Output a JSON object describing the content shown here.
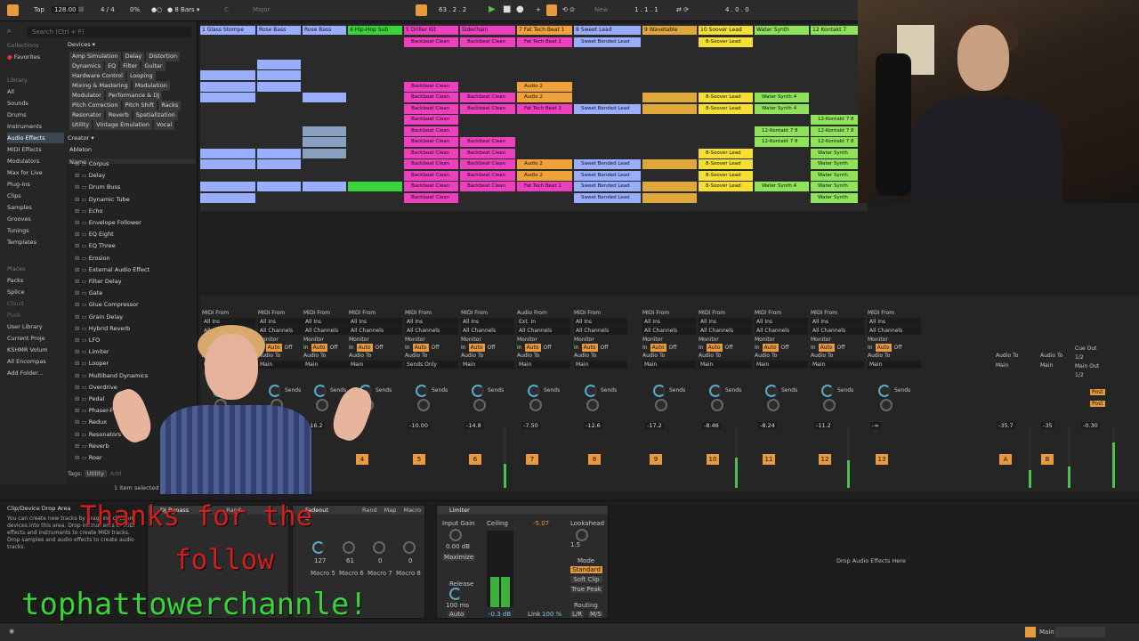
{
  "transport": {
    "tap": "Tap",
    "bpm": "128.00",
    "signature": "4 / 4",
    "cpu": "0%",
    "quantize": "8 Bars",
    "key": "C",
    "scale": "Major",
    "position": "63 .  2 .  2",
    "new_label": "New",
    "loop_start": "1 .  1 .  1",
    "loop_len": "4 .  0 .  0"
  },
  "browser": {
    "search_placeholder": "Search (Ctrl + F)",
    "collections_header": "Collections",
    "favorites": "Favorites",
    "library_header": "Library",
    "library_items": [
      "All",
      "Sounds",
      "Drums",
      "Instruments",
      "Audio Effects",
      "MIDI Effects",
      "Modulators",
      "Max for Live",
      "Plug-Ins",
      "Clips",
      "Samples",
      "Grooves",
      "Tunings",
      "Templates"
    ],
    "places_header": "Places",
    "places_items": [
      "Packs",
      "Splice",
      "Cloud",
      "Push",
      "User Library",
      "Current Proje",
      "KSHMR Volum",
      "All Encompas",
      "Add Folder..."
    ],
    "devices_label": "Devices ▾",
    "tag_rows": [
      [
        "Amp Simulation",
        "Delay",
        "Distortion"
      ],
      [
        "Dynamics",
        "EQ",
        "Filter",
        "Guitar"
      ],
      [
        "Hardware Control",
        "Looping"
      ],
      [
        "Mixing & Mastering",
        "Modulation"
      ],
      [
        "Modulator",
        "Performance & DJ"
      ],
      [
        "Pitch Correction",
        "Pitch Shift",
        "Racks"
      ],
      [
        "Resonator",
        "Reverb",
        "Spatialization"
      ],
      [
        "Utility",
        "Vintage Emulation",
        "Vocal"
      ]
    ],
    "creator_label": "Creator ▾",
    "creator_value": "Ableton",
    "name_col": "Name",
    "files": [
      "Corpus",
      "Delay",
      "Drum Buss",
      "Dynamic Tube",
      "Echo",
      "Envelope Follower",
      "EQ Eight",
      "EQ Three",
      "Erosion",
      "External Audio Effect",
      "Filter Delay",
      "Gate",
      "Glue Compressor",
      "Grain Delay",
      "Hybrid Reverb",
      "LFO",
      "Limiter",
      "Looper",
      "Multiband Dynamics",
      "Overdrive",
      "Pedal",
      "Phaser-Flanger",
      "Redux",
      "Resonators",
      "Reverb",
      "Roar"
    ],
    "tags_label": "Tags:",
    "tags_value": "Utility",
    "tags_add": "Add",
    "selected_count": "1 item selected"
  },
  "tracks": [
    {
      "name": "1 Glass Stompe",
      "color": "#9aaeff"
    },
    {
      "name": "Rose Bass",
      "color": "#9aaeff"
    },
    {
      "name": "Rose Bass",
      "color": "#9aaeff"
    },
    {
      "name": "4 Hip-Hop Sub",
      "color": "#39d439"
    },
    {
      "name": "5 Driller Kit",
      "color": "#ee3fbf"
    },
    {
      "name": "Sidechain",
      "color": "#ee3fbf"
    },
    {
      "name": "7 Fat Tech Beat 1",
      "color": "#f0a23a"
    },
    {
      "name": "8 Sweet Lead",
      "color": "#9aaeff"
    },
    {
      "name": "9 Wavetable",
      "color": "#e0a83a"
    },
    {
      "name": "10 Soover Lead",
      "color": "#f5df34"
    },
    {
      "name": "Water Synth",
      "color": "#8fe35a"
    },
    {
      "name": "12 Kontakt 7",
      "color": "#8fe35a"
    }
  ],
  "clips": {
    "backbeat": "Backbeat Clean",
    "fattech": "Fat Tech Beat 1",
    "sweet": "Sweet Bended Lead",
    "soover": "8-Soover Lead",
    "water": "Water Synth 4",
    "kontakt": "12-Kontakt 7 8",
    "audio2": "Audio 2",
    "water_short": "Water Synth"
  },
  "io": {
    "midi_from": "MIDI From",
    "audio_from": "Audio From",
    "all_ins": "All Ins",
    "ext_in": "Ext. In",
    "all_channels": "All Channels",
    "monitor": "Monitor",
    "in": "In",
    "auto": "Auto",
    "off": "Off",
    "audio_to": "Audio To",
    "main": "Main",
    "sends_only": "Sends Only",
    "sends": "Sends",
    "cue_out": "Cue Out",
    "cue_val": "1/2",
    "main_out": "Main Out",
    "main_val": "1/2",
    "post": "Post"
  },
  "mixer": {
    "volumes": [
      "-16.2",
      "-10.00",
      "-14.8",
      "-7.50",
      "-12.6",
      "-17.2",
      "-8.46",
      "-8.24",
      "-11.2",
      "-∞",
      "-35.7",
      "-35",
      "-0.30"
    ],
    "numbers": [
      "4",
      "5",
      "6",
      "7",
      "8",
      "9",
      "10",
      "11",
      "12",
      "13"
    ],
    "return_labels": [
      "A",
      "B"
    ],
    "slot_counts": [
      "1",
      "32",
      "1",
      "32",
      "1",
      "32",
      "1",
      "32",
      "4",
      "8",
      "1",
      "32",
      "1",
      "32"
    ]
  },
  "devices": {
    "drop_title": "Clip/Device Drop Area",
    "drop_text": "You can create new tracks by dragging clips and devices into this area. Drop instruments or MIDI effects and instruments to create MIDI tracks. Drop samples and audio effects to create audio tracks.",
    "rack_name": "DJ Bypass",
    "fadeout": "Fadeout",
    "rand": "Rand",
    "map": "Map",
    "macros": [
      "Macro 4",
      "Macro 5",
      "Macro 6",
      "Macro 7",
      "Macro 8"
    ],
    "macro_vals": [
      "127",
      "61",
      "0",
      "0"
    ],
    "limiter": "Limiter",
    "input_gain": "Input Gain",
    "ceiling": "Ceiling",
    "ceiling_val": "-5.07",
    "gain_val": "0.00 dB",
    "maximize": "Maximize",
    "lookahead": "Lookahead",
    "lookahead_val": "1.5",
    "release": "Release",
    "release_val": "100 ms",
    "release_mode": "Auto",
    "mode": "Mode",
    "modes": [
      "Standard",
      "Soft Clip",
      "True Peak"
    ],
    "routing": "Routing",
    "routing_val": "L/R",
    "ms_val": "M/S",
    "link": "Link",
    "link_val": "100 %",
    "gr_val": "-0.3 dB",
    "drop_fx": "Drop Audio Effects Here"
  },
  "status": {
    "main": "Main"
  },
  "overlay": {
    "line1": "Thanks for the",
    "line2": "follow",
    "line3": "tophattowerchannle!"
  },
  "colors": {
    "accent": "#e89a3c",
    "overlay_red": "#d11e1e",
    "overlay_green": "#38d438"
  }
}
